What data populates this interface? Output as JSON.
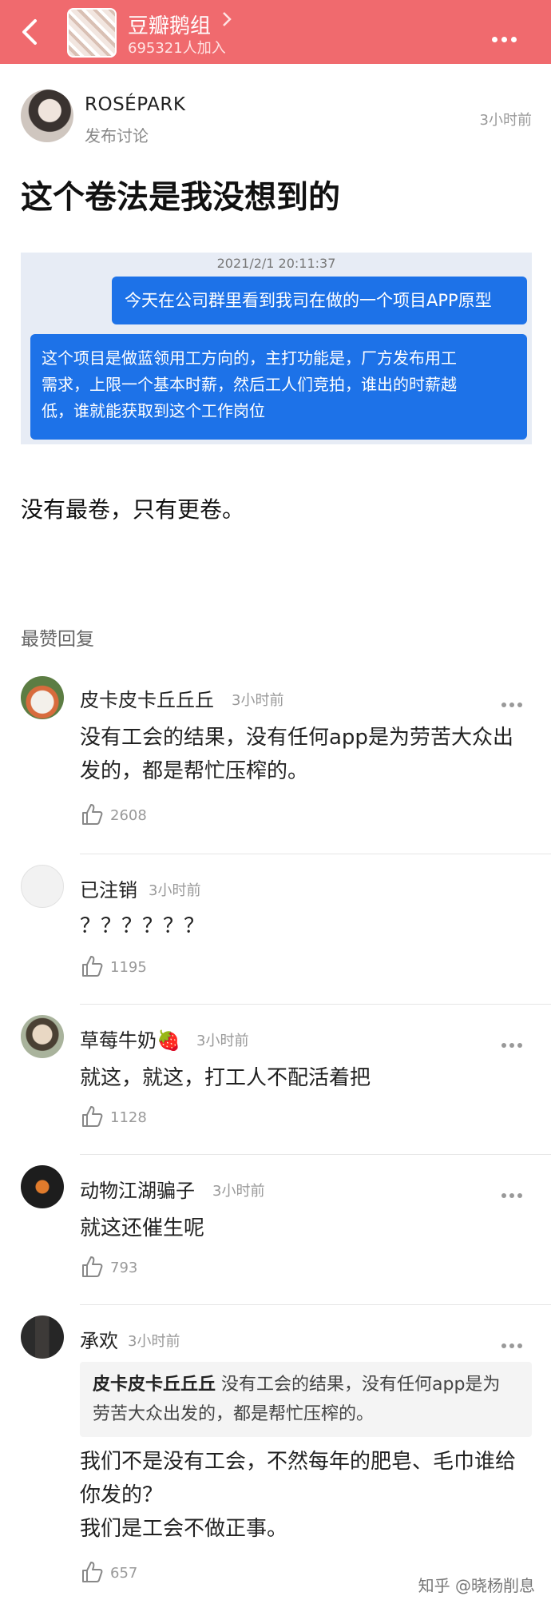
{
  "header": {
    "group_name": "豆瓣鹅组",
    "member_count": "695321人加入",
    "back_icon": "chevron-left-icon",
    "more_icon": "more-horizontal-icon",
    "bar_color": "#f06a6e"
  },
  "post": {
    "author": "ROSÉPARK",
    "action": "发布讨论",
    "time": "3小时前",
    "title": "这个卷法是我没想到的",
    "screenshot": {
      "timestamp": "2021/2/1 20:11:37",
      "message_out": "今天在公司群里看到我司在做的一个项目APP原型",
      "message_in_lines": [
        "这个项目是做蓝领用工方向的，主打功能是，厂方发布用工",
        "需求，上限一个基本时薪，然后工人们竞拍，谁出的时薪越",
        "低，谁就能获取到这个工作岗位"
      ]
    },
    "body": "没有最卷，只有更卷。"
  },
  "section_label": "最赞回复",
  "comments": [
    {
      "name": "皮卡皮卡丘丘丘",
      "time": "3小时前",
      "lines": [
        "没有工会的结果，没有任何app是为劳苦大众出",
        "发的，都是帮忙压榨的。"
      ],
      "likes": "2608"
    },
    {
      "name": "已注销",
      "time": "3小时前",
      "lines": [
        "？？？？？？"
      ],
      "likes": "1195"
    },
    {
      "name": "草莓牛奶🍓",
      "time": "3小时前",
      "lines": [
        "就这，就这，打工人不配活着把"
      ],
      "likes": "1128"
    },
    {
      "name": "动物江湖骗子",
      "time": "3小时前",
      "lines": [
        "就这还催生呢"
      ],
      "likes": "793"
    },
    {
      "name": "承欢",
      "time": "3小时前",
      "quote_author": "皮卡皮卡丘丘丘",
      "quote_line1": "没有工会的结果，没有任何app是为",
      "quote_line2": "劳苦大众出发的，都是帮忙压榨的。",
      "lines": [
        "我们不是没有工会，不然每年的肥皂、毛巾谁给",
        "你发的？",
        "我们是工会不做正事。"
      ],
      "likes": "657"
    }
  ],
  "watermark": "知乎 @晓杨削息"
}
